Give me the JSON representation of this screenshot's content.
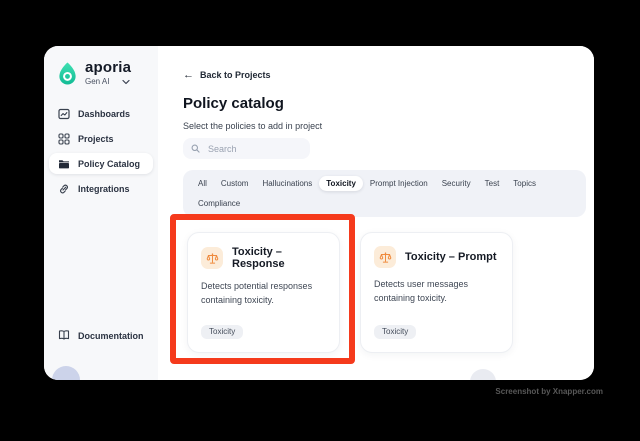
{
  "sidebar": {
    "brand": {
      "name": "aporia",
      "workspace": "Gen AI"
    },
    "items": [
      {
        "label": "Dashboards",
        "selected": false
      },
      {
        "label": "Projects",
        "selected": false
      },
      {
        "label": "Policy Catalog",
        "selected": true
      },
      {
        "label": "Integrations",
        "selected": false
      }
    ],
    "footer_item": {
      "label": "Documentation"
    }
  },
  "main": {
    "back_link": "Back to Projects",
    "title": "Policy catalog",
    "subtitle": "Select the policies to add in project",
    "search": {
      "placeholder": "Search"
    },
    "tabs": [
      "All",
      "Custom",
      "Hallucinations",
      "Toxicity",
      "Prompt Injection",
      "Security",
      "Test",
      "Topics",
      "Compliance"
    ],
    "selected_tab": "Toxicity",
    "cards": [
      {
        "title": "Toxicity – Response",
        "description": "Detects potential responses containing toxicity.",
        "tag": "Toxicity",
        "icon": "scales-icon",
        "highlighted": true
      },
      {
        "title": "Toxicity – Prompt",
        "description": "Detects user messages containing toxicity.",
        "tag": "Toxicity",
        "icon": "scales-icon",
        "highlighted": false
      }
    ]
  },
  "watermark": "Screenshot by Xnapper.com",
  "colors": {
    "brand_teal": "#22d3a7",
    "card_icon_orange": "#ef8a3d",
    "card_icon_bg": "#fcecd9",
    "highlight_red": "#f53a1c",
    "sidebar_bg": "#f7f8fa",
    "tabbar_bg": "#f0f2f7"
  }
}
